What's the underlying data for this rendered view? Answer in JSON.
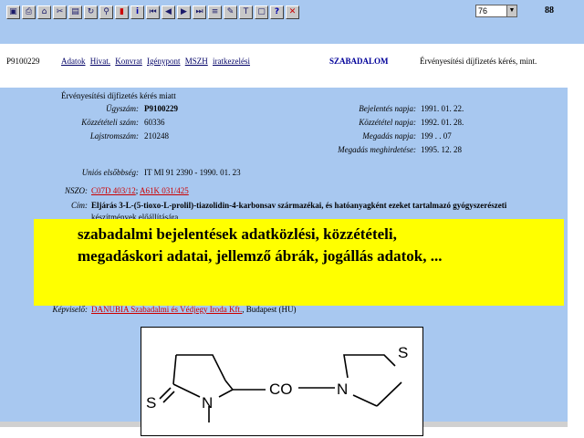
{
  "toolbar": {
    "buttons": [
      {
        "icon": "first-page-icon",
        "glyph": "▣"
      },
      {
        "icon": "save-icon",
        "glyph": "⎙"
      },
      {
        "icon": "print-icon",
        "glyph": "⌂"
      },
      {
        "icon": "copy-icon",
        "glyph": "✂"
      },
      {
        "icon": "paste-icon",
        "glyph": "▤"
      },
      {
        "icon": "refresh-icon",
        "glyph": "↻"
      },
      {
        "icon": "search-icon",
        "glyph": "⚲"
      },
      {
        "icon": "bookmark-icon",
        "glyph": "▮"
      },
      {
        "icon": "info-icon",
        "glyph": "i"
      },
      {
        "icon": "first-record-icon",
        "glyph": "⏮"
      },
      {
        "icon": "previous-icon",
        "glyph": "◀"
      },
      {
        "icon": "next-icon",
        "glyph": "▶"
      },
      {
        "icon": "last-record-icon",
        "glyph": "⏭"
      },
      {
        "icon": "list-icon",
        "glyph": "≡"
      },
      {
        "icon": "edit-icon",
        "glyph": "✎"
      },
      {
        "icon": "text-icon",
        "glyph": "T"
      },
      {
        "icon": "window-icon",
        "glyph": "▢"
      },
      {
        "icon": "help-icon",
        "glyph": "?"
      },
      {
        "icon": "close-icon",
        "glyph": "✕"
      }
    ],
    "zoom_value": "76",
    "page_number": "88"
  },
  "header": {
    "doc_id": "P9100229",
    "nav_links": [
      "Adatok",
      "Hivat.",
      "Konvrat",
      "Igénypont",
      "MSZH",
      "iratkezelési"
    ],
    "section_title": "SZABADALOM",
    "doc_title_short": "Érvényesítési díjfizetés kérés, mint."
  },
  "record": {
    "status_line": "Érvényesítési díjfizetés kérés miatt",
    "left_fields": [
      {
        "label": "Ügyszám:",
        "value": "P9100229"
      },
      {
        "label": "Közzétételi szám:",
        "value": "60336"
      },
      {
        "label": "Lajstromszám:",
        "value": "210248"
      }
    ],
    "right_fields": [
      {
        "label": "Bejelentés napja:",
        "value": "1991. 01. 22."
      },
      {
        "label": "Közzététel napja:",
        "value": "1992. 01. 28."
      },
      {
        "label": "Megadás napja:",
        "value": "199 . . 07"
      },
      {
        "label": "Megadás meghirdetése:",
        "value": "1995. 12. 28"
      }
    ],
    "priority_label": "Uniós elsőbbség:",
    "priority_value": "IT MI 91 2390 - 1990. 01. 23",
    "ipc_label": "NSZO:",
    "ipc_links": [
      "C07D 403/12",
      "A61K 031/425"
    ],
    "title_label": "Cím:",
    "title_line1": "Eljárás 3-L-(5-tioxo-L-prolil)-tiazolidin-4-karbonsav származékai, és hatóanyagként ezeket tartalmazó gyógyszerészeti",
    "title_line2": "készítmények előállítására",
    "representative_label": "Képviselő:",
    "representative_link": "DANUBIA Szabadalmi és Védjegy Iroda Kft.",
    "representative_rest": ", Budapest (HU)"
  },
  "overlay": {
    "line1": "szabadalmi bejelentések adatközlési, közzétételi,",
    "line2": "megadáskori adatai, jellemző ábrák, jogállás adatok, ..."
  },
  "structure": {
    "atoms": [
      "S",
      "N",
      "CO",
      "N",
      "S"
    ]
  }
}
